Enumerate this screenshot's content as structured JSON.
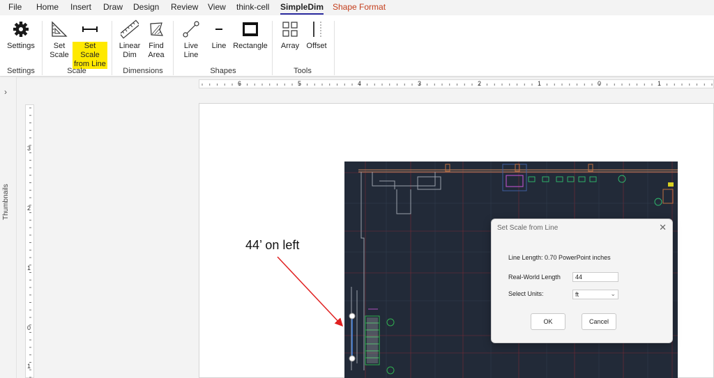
{
  "tabs": [
    "File",
    "Home",
    "Insert",
    "Draw",
    "Design",
    "Review",
    "View",
    "think-cell",
    "SimpleDim",
    "Shape Format"
  ],
  "ribbon": {
    "settings": {
      "label": "Settings",
      "group": "Settings"
    },
    "scale": {
      "set_scale": "Set\nScale",
      "set_scale_from_line": "Set Scale\nfrom Line",
      "group": "Scale"
    },
    "dimensions": {
      "linear_dim": "Linear\nDim",
      "find_area": "Find\nArea",
      "group": "Dimensions"
    },
    "shapes": {
      "live_line": "Live\nLine",
      "line": "Line",
      "rectangle": "Rectangle",
      "group": "Shapes"
    },
    "tools": {
      "array": "Array",
      "offset": "Offset",
      "group": "Tools"
    }
  },
  "thumbnails_label": "Thumbnails",
  "hruler_numbers": [
    "6",
    "5",
    "4",
    "3",
    "2",
    "1",
    "0",
    "1"
  ],
  "vruler_numbers": [
    "3",
    "2",
    "1",
    "0",
    "1"
  ],
  "callout_text": "44’ on left",
  "dialog": {
    "title": "Set Scale from Line",
    "close": "✕",
    "line_length": "Line Length: 0.70 PowerPoint inches",
    "real_world_label": "Real-World Length",
    "real_world_value": "44",
    "units_label": "Select Units:",
    "units_value": "ft",
    "ok": "OK",
    "cancel": "Cancel"
  },
  "colors": {
    "accent_tab": "#2b2b9f",
    "shape_format": "#c43e1c",
    "highlight": "#ffe900",
    "cad_bg": "#222a38",
    "arrow": "#e02020"
  }
}
